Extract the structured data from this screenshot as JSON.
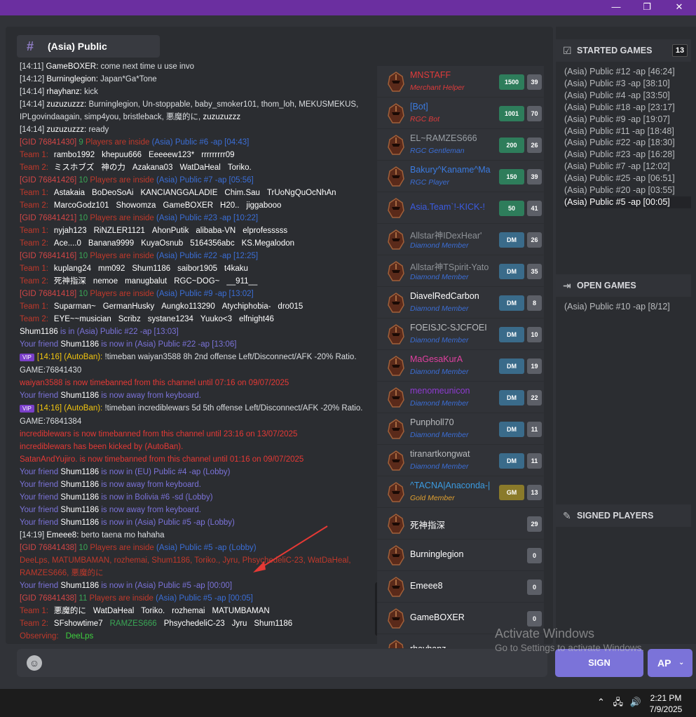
{
  "window": {
    "minimize": "—",
    "maximize": "❐",
    "close": "✕"
  },
  "channel": {
    "title": "(Asia) Public"
  },
  "messages": [
    {
      "type": "chat",
      "time": "[14:11]",
      "name": "GameBOXER:",
      "text": "come next time u use invo"
    },
    {
      "type": "chat",
      "time": "[14:12]",
      "name": "Burninglegion:",
      "text": "Japan*Ga*Tone"
    },
    {
      "type": "chat",
      "time": "[14:14]",
      "name": "rhayhanz:",
      "text": "kick"
    },
    {
      "type": "chat",
      "time": "[14:14]",
      "name": "zuzuzuzzz:",
      "text": "Burninglegion, Un-stoppable, baby_smoker101, thom_loh, MEKUSMEKUS, IPLgovindaagain, simp4you, bristleback, 悪魔的に,",
      "tail": "zuzuzuzzz"
    },
    {
      "type": "chat",
      "time": "[14:14]",
      "name": "zuzuzuzzz:",
      "text": "ready"
    },
    {
      "type": "gid",
      "gid": "[GID 76841430]",
      "slot": "9",
      "rest": "Players are inside",
      "chan": "(Asia) Public #6 -ap [04:43]"
    },
    {
      "type": "team",
      "label": "Team 1:",
      "players": [
        "rambo1992",
        "khepuu666",
        "Eeeeew123*",
        "rrrrrrrrr09"
      ]
    },
    {
      "type": "team",
      "label": "Team 2:",
      "players": [
        "ミスホブズ",
        "神の力",
        "Azakana03",
        "WatDaHeal",
        "Toriko."
      ]
    },
    {
      "type": "gid",
      "gid": "[GID 76841426]",
      "slot": "10",
      "rest": "Players are inside",
      "chan": "(Asia) Public #7 -ap [05:56]"
    },
    {
      "type": "team",
      "label": "Team 1:",
      "players": [
        "Astakaia",
        "BoDeoSoAi",
        "KANCIANGGALADIE",
        "Chim.Sau",
        "TrUoNgQuOcNhAn"
      ]
    },
    {
      "type": "team",
      "label": "Team 2:",
      "players": [
        "MarcoGodz101",
        "Showomza",
        "GameBOXER",
        "H20..",
        "jiggabooo"
      ]
    },
    {
      "type": "gid",
      "gid": "[GID 76841421]",
      "slot": "10",
      "rest": "Players are inside",
      "chan": "(Asia) Public #23 -ap [10:22]"
    },
    {
      "type": "team",
      "label": "Team 1:",
      "players": [
        "nyjah123",
        "RiNZLER1121",
        "AhonPutik",
        "alibaba-VN",
        "elprofesssss"
      ]
    },
    {
      "type": "team",
      "label": "Team 2:",
      "players": [
        "Ace....0",
        "Banana9999",
        "KuyaOsnub",
        "5164356abc",
        "KS.Megalodon"
      ]
    },
    {
      "type": "gid",
      "gid": "[GID 76841416]",
      "slot": "10",
      "rest": "Players are inside",
      "chan": "(Asia) Public #22 -ap [12:25]"
    },
    {
      "type": "team",
      "label": "Team 1:",
      "players": [
        "kuplang24",
        "mm092",
        "Shum1186",
        "saibor1905",
        "t4kaku"
      ]
    },
    {
      "type": "team",
      "label": "Team 2:",
      "players": [
        "死神指深",
        "nemoe",
        "manugbalut",
        "RGC~DOG~",
        "__911__"
      ]
    },
    {
      "type": "gid",
      "gid": "[GID 76841418]",
      "slot": "10",
      "rest": "Players are inside",
      "chan": "(Asia) Public #9 -ap [13:02]"
    },
    {
      "type": "team",
      "label": "Team 1:",
      "players": [
        "Suparman~",
        "GermanHusky",
        "Aungko113290",
        "Atychiphobia-",
        "dro015"
      ]
    },
    {
      "type": "team",
      "label": "Team 2:",
      "players": [
        "EYE~~musician",
        "Scribz",
        "systane1234",
        "Yuuko<3",
        "elfnight46"
      ]
    },
    {
      "type": "friend",
      "name": "Shum1186",
      "pre": "",
      "text": "is in (Asia) Public #22 -ap [13:03]",
      "plainname": true
    },
    {
      "type": "friend",
      "pre": "Your friend",
      "name": "Shum1186",
      "text": "is now in (Asia) Public #22 -ap [13:06]"
    },
    {
      "type": "vip",
      "badge": "VIP",
      "time": "[14:16]",
      "who": "(AutoBan):",
      "text": "!timeban waiyan3588 8h 2nd offense Left/Disconnect/AFK -20% Ratio. GAME:76841430"
    },
    {
      "type": "ban",
      "text": "waiyan3588 is now timebanned from this channel until 07:16 on 09/07/2025"
    },
    {
      "type": "friend",
      "pre": "Your friend",
      "name": "Shum1186",
      "text": "is now away from keyboard."
    },
    {
      "type": "vip",
      "badge": "VIP",
      "time": "[14:16]",
      "who": "(AutoBan):",
      "text": "!timeban incrediblewars 5d 5th offense Left/Disconnect/AFK -20% Ratio. GAME:76841384"
    },
    {
      "type": "ban",
      "text": "incrediblewars is now timebanned from this channel until 23:16 on 13/07/2025"
    },
    {
      "type": "ban",
      "text": "incrediblewars has been kicked by (AutoBan)."
    },
    {
      "type": "ban",
      "text": "SatanAndYujiro. is now timebanned from this channel until 01:16 on 09/07/2025"
    },
    {
      "type": "friend",
      "pre": "Your friend",
      "name": "Shum1186",
      "text": "is now in (EU) Public #4 -ap (Lobby)"
    },
    {
      "type": "friend",
      "pre": "Your friend",
      "name": "Shum1186",
      "text": "is now away from keyboard."
    },
    {
      "type": "friend",
      "pre": "Your friend",
      "name": "Shum1186",
      "text": "is now in Bolivia #6 -sd (Lobby)"
    },
    {
      "type": "friend",
      "pre": "Your friend",
      "name": "Shum1186",
      "text": "is now away from keyboard."
    },
    {
      "type": "friend",
      "pre": "Your friend",
      "name": "Shum1186",
      "text": "is now in (Asia) Public #5 -ap (Lobby)"
    },
    {
      "type": "chat",
      "time": "[14:19]",
      "name": "Emeee8:",
      "text": "berto taena mo hahaha"
    },
    {
      "type": "gid",
      "gid": "[GID 76841438]",
      "slot": "10",
      "rest": "Players are inside",
      "chan": "(Asia) Public #5 -ap (Lobby)"
    },
    {
      "type": "banlist",
      "text": "DeeLps, MATUMBAMAN, rozhemai, Shum1186, Toriko., Jyru, PhsychedeliC-23, WatDaHeal, RAMZES666, 悪魔的に"
    },
    {
      "type": "friend",
      "pre": "Your friend",
      "name": "Shum1186",
      "text": "is now in (Asia) Public #5 -ap [00:00]"
    },
    {
      "type": "gid",
      "gid": "[GID 76841438]",
      "slot": "11",
      "rest": "Players are inside",
      "chan": "(Asia) Public #5 -ap [00:05]"
    },
    {
      "type": "team",
      "label": "Team 1:",
      "players": [
        "悪魔的に",
        "WatDaHeal",
        "Toriko.",
        "rozhemai",
        "MATUMBAMAN"
      ]
    },
    {
      "type": "team2",
      "label": "Team 2:",
      "players": [
        "SFshowtime7",
        "RAMZES666",
        "PhsychedeliC-23",
        "Jyru",
        "Shum1186"
      ]
    },
    {
      "type": "observe",
      "label": "Observing:",
      "name": "DeeLps"
    }
  ],
  "players": [
    {
      "name": "MNSTAFF",
      "role": "Merchant Helper",
      "name_color": "#e03b3b",
      "role_color": "#e03b3b",
      "pts": "1500",
      "pts_color": "#2e7d5b",
      "lvl": "39"
    },
    {
      "name": "[Bot]",
      "role": "RGC Bot",
      "name_color": "#3b7be0",
      "role_color": "#e03b3b",
      "pts": "1001",
      "pts_color": "#2e7d5b",
      "lvl": "70"
    },
    {
      "name": "EL~RAMZES666",
      "role": "RGC Gentleman",
      "name_color": "#9aa0a6",
      "name2_color": "#3aa655",
      "role_color": "#3b6ed6",
      "pts": "200",
      "pts_color": "#2e7d5b",
      "lvl": "26"
    },
    {
      "name": "Bakury^Kaname^Ma",
      "role": "RGC Player",
      "name_color": "#3b7be0",
      "role_color": "#3b6ed6",
      "pts": "150",
      "pts_color": "#2e7d5b",
      "lvl": "39"
    },
    {
      "name": "Asia.Team`!-KICK-!",
      "role": "",
      "name_color": "#3b5be0",
      "role_color": "#3b6ed6",
      "pts": "50",
      "pts_color": "#2e7d5b",
      "lvl": "41"
    },
    {
      "name": "Allstar神IDexHear'",
      "role": "Diamond Member",
      "name_color": "#8e9297",
      "role_color": "#3b6ed6",
      "pts": "DM",
      "pts_color": "#3a6b8a",
      "lvl": "26"
    },
    {
      "name": "Allstar神TSpirit-Yato",
      "role": "Diamond Member",
      "name_color": "#8e9297",
      "role_color": "#3b6ed6",
      "pts": "DM",
      "pts_color": "#3a6b8a",
      "lvl": "35"
    },
    {
      "name": "DiavelRedCarbon",
      "role": "Diamond Member",
      "name_color": "#ffffff",
      "role_color": "#3b6ed6",
      "pts": "DM",
      "pts_color": "#3a6b8a",
      "lvl": "8"
    },
    {
      "name": "FOEISJC-SJCFOEI",
      "role": "Diamond Member",
      "name_color": "#b9bbbe",
      "role_color": "#3b6ed6",
      "pts": "DM",
      "pts_color": "#3a6b8a",
      "lvl": "10"
    },
    {
      "name": "MaGesaKurA",
      "role": "Diamond Member",
      "name_color": "#e040a0",
      "role_color": "#3b6ed6",
      "pts": "DM",
      "pts_color": "#3a6b8a",
      "lvl": "19"
    },
    {
      "name": "menomeunicon",
      "role": "Diamond Member",
      "name_color": "#8e3bd0",
      "role_color": "#3b6ed6",
      "pts": "DM",
      "pts_color": "#3a6b8a",
      "lvl": "22"
    },
    {
      "name": "Punpholl70",
      "role": "Diamond Member",
      "name_color": "#b9bbbe",
      "role_color": "#3b6ed6",
      "pts": "DM",
      "pts_color": "#3a6b8a",
      "lvl": "11"
    },
    {
      "name": "tiranartkongwat",
      "role": "Diamond Member",
      "name_color": "#b9bbbe",
      "role_color": "#3b6ed6",
      "pts": "DM",
      "pts_color": "#3a6b8a",
      "lvl": "11"
    },
    {
      "name": "^TACNA|Anaconda-|",
      "role": "Gold Member",
      "name_color": "#3b9be0",
      "role_color": "#e0a030",
      "pts": "GM",
      "pts_color": "#8a7a2a",
      "lvl": "13"
    },
    {
      "name": "死神指深",
      "role": "",
      "name_color": "#ffffff",
      "role_color": "",
      "pts": "",
      "pts_color": "",
      "lvl": "29"
    },
    {
      "name": "Burninglegion",
      "role": "",
      "name_color": "#ffffff",
      "role_color": "",
      "pts": "",
      "pts_color": "",
      "lvl": "0"
    },
    {
      "name": "Emeee8",
      "role": "",
      "name_color": "#ffffff",
      "role_color": "",
      "pts": "",
      "pts_color": "",
      "lvl": "0"
    },
    {
      "name": "GameBOXER",
      "role": "",
      "name_color": "#ffffff",
      "role_color": "",
      "pts": "",
      "pts_color": "",
      "lvl": "0"
    },
    {
      "name": "rhayhanz",
      "role": "",
      "name_color": "#ffffff",
      "role_color": "",
      "pts": "",
      "pts_color": "",
      "lvl": ""
    }
  ],
  "started_games": {
    "title": "STARTED GAMES",
    "count": "13",
    "items": [
      "(Asia) Public #12 -ap [46:24]",
      "(Asia) Public #3 -ap [38:10]",
      "(Asia) Public #4 -ap [33:50]",
      "(Asia) Public #18 -ap [23:17]",
      "(Asia) Public #9 -ap [19:07]",
      "(Asia) Public #11 -ap [18:48]",
      "(Asia) Public #22 -ap [18:30]",
      "(Asia) Public #23 -ap [16:28]",
      "(Asia) Public #7 -ap [12:02]",
      "(Asia) Public #25 -ap [06:51]",
      "(Asia) Public #20 -ap [03:55]",
      "(Asia) Public #5 -ap [00:05]"
    ]
  },
  "open_games": {
    "title": "OPEN GAMES",
    "items": [
      "(Asia) Public #10 -ap [8/12]"
    ]
  },
  "signed_players": {
    "title": "SIGNED PLAYERS"
  },
  "input": {
    "emoji": "☺"
  },
  "buttons": {
    "sign": "SIGN",
    "mode": "AP"
  },
  "watermark": {
    "line1": "Activate Windows",
    "line2": "Go to Settings to activate Windows."
  },
  "taskbar": {
    "time": "2:21 PM",
    "date": "7/9/2025"
  },
  "colors": {
    "accent": "#7b73d9",
    "titlebar": "#6b2fa0"
  }
}
